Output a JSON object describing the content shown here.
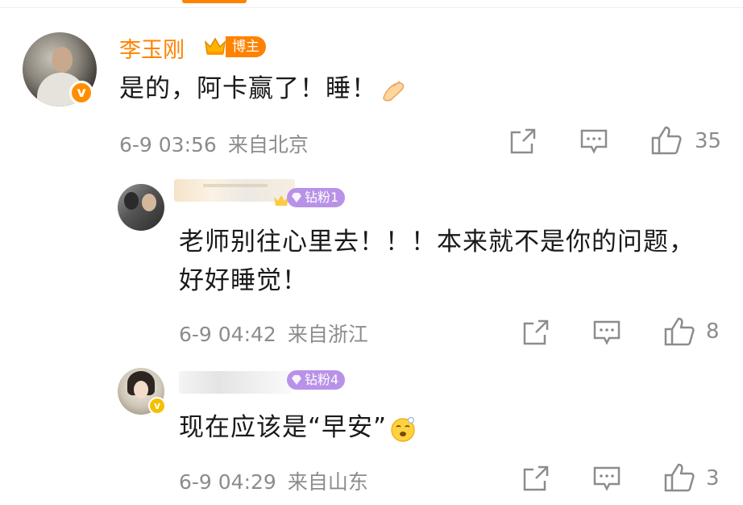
{
  "main_comment": {
    "username": "李玉刚",
    "badge": "博主",
    "text": "是的，阿卡赢了！睡！",
    "time": "6-9 03:56",
    "location": "来自北京",
    "likes": "35"
  },
  "replies": [
    {
      "fan_badge": "钻粉1",
      "text": "老师别往心里去！！！本来就不是你的问题，好好睡觉！",
      "time": "6-9 04:42",
      "location": "来自浙江",
      "likes": "8"
    },
    {
      "fan_badge": "钻粉4",
      "text": "现在应该是“早安”",
      "time": "6-9 04:29",
      "location": "来自山东",
      "likes": "3"
    }
  ],
  "icons": [
    "share-icon",
    "comment-icon",
    "like-icon",
    "verified-icon",
    "crown-icon",
    "pinched-fingers-emoji",
    "yawn-emoji"
  ],
  "colors": {
    "accent": "#ff8200",
    "fan_badge": "#b892e8",
    "meta_text": "#8c8c8c"
  }
}
